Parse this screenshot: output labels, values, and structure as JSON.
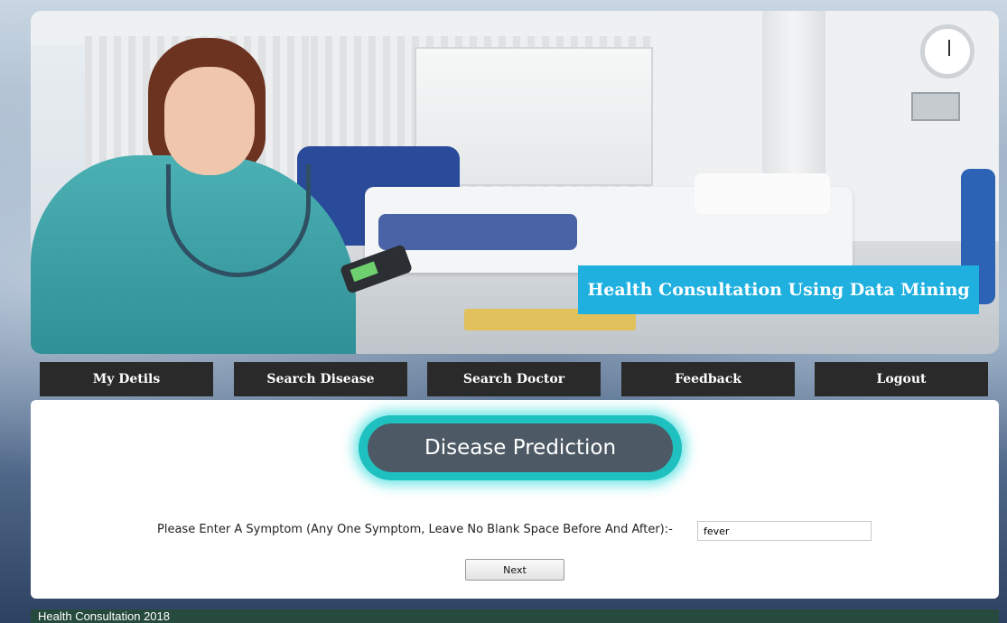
{
  "banner": {
    "title": "Health Consultation Using Data Mining"
  },
  "nav": {
    "items": [
      {
        "label": "My Detils"
      },
      {
        "label": "Search Disease"
      },
      {
        "label": "Search Doctor"
      },
      {
        "label": "Feedback"
      },
      {
        "label": "Logout"
      }
    ]
  },
  "main": {
    "heading": "Disease Prediction",
    "prompt": "Please Enter A Symptom (Any One Symptom, Leave No Blank Space Before And After):-",
    "symptom_value": "fever",
    "next_label": "Next"
  },
  "footer": {
    "text": "Health Consultation 2018"
  },
  "colors": {
    "nav_bg": "#2a2a2a",
    "banner_title_bg": "#1fb0e0",
    "heading_pill": "#4d5a65",
    "heading_glow": "#1fc0c0",
    "footer_bg": "#274a3e"
  }
}
